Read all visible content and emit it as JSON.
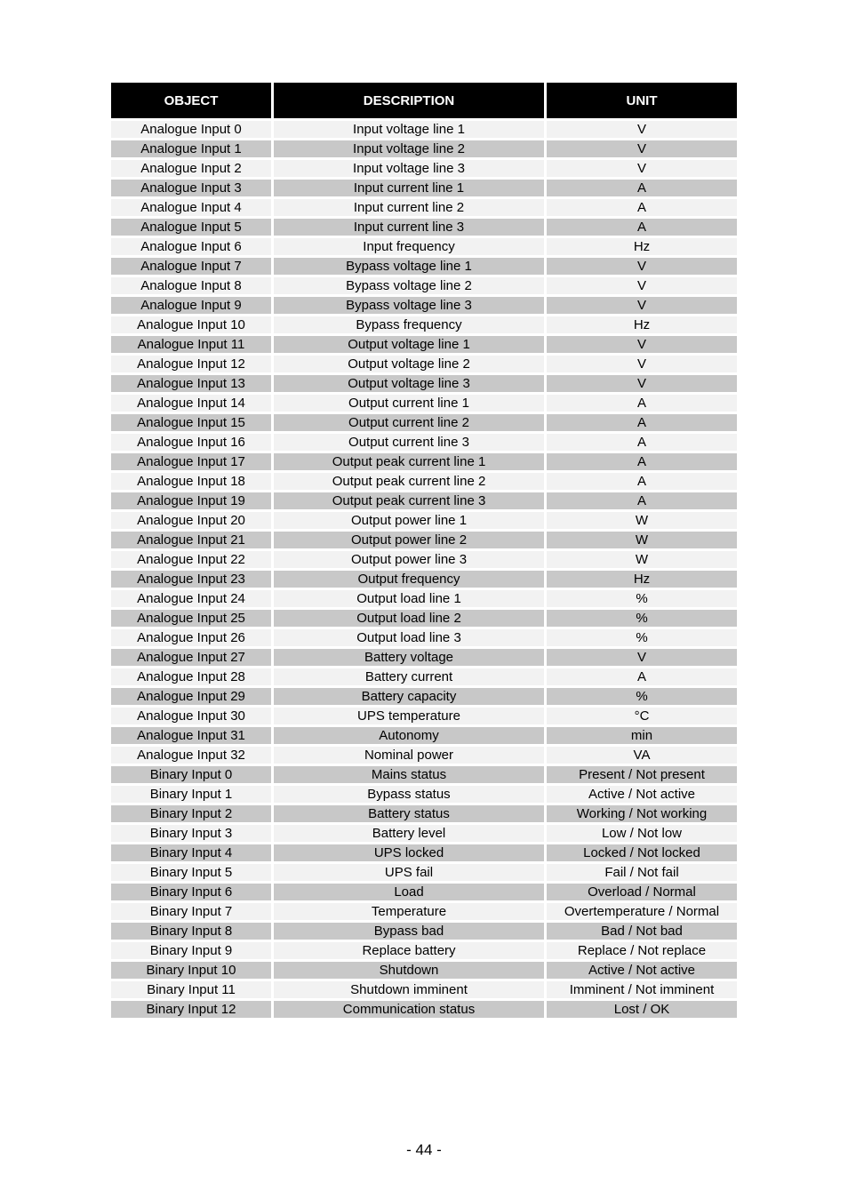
{
  "table": {
    "headers": {
      "object": "OBJECT",
      "description": "DESCRIPTION",
      "unit": "UNIT"
    },
    "colors": {
      "header_bg": "#000000",
      "row_light": "#f2f2f2",
      "row_dark": "#c8c8c8"
    },
    "rows": [
      {
        "object": "Analogue Input 0",
        "description": "Input voltage line 1",
        "unit": "V"
      },
      {
        "object": "Analogue Input 1",
        "description": "Input voltage line 2",
        "unit": "V"
      },
      {
        "object": "Analogue Input 2",
        "description": "Input voltage line 3",
        "unit": "V"
      },
      {
        "object": "Analogue Input 3",
        "description": "Input current line 1",
        "unit": "A"
      },
      {
        "object": "Analogue Input 4",
        "description": "Input current line 2",
        "unit": "A"
      },
      {
        "object": "Analogue Input 5",
        "description": "Input current line 3",
        "unit": "A"
      },
      {
        "object": "Analogue Input 6",
        "description": "Input frequency",
        "unit": "Hz"
      },
      {
        "object": "Analogue Input 7",
        "description": "Bypass voltage line 1",
        "unit": "V"
      },
      {
        "object": "Analogue Input 8",
        "description": "Bypass voltage line 2",
        "unit": "V"
      },
      {
        "object": "Analogue Input 9",
        "description": "Bypass voltage line 3",
        "unit": "V"
      },
      {
        "object": "Analogue Input 10",
        "description": "Bypass frequency",
        "unit": "Hz"
      },
      {
        "object": "Analogue Input 11",
        "description": "Output voltage line 1",
        "unit": "V"
      },
      {
        "object": "Analogue Input 12",
        "description": "Output voltage line 2",
        "unit": "V"
      },
      {
        "object": "Analogue Input 13",
        "description": "Output voltage line 3",
        "unit": "V"
      },
      {
        "object": "Analogue Input 14",
        "description": "Output current line 1",
        "unit": "A"
      },
      {
        "object": "Analogue Input 15",
        "description": "Output current line 2",
        "unit": "A"
      },
      {
        "object": "Analogue Input 16",
        "description": "Output current line 3",
        "unit": "A"
      },
      {
        "object": "Analogue Input 17",
        "description": "Output peak current line 1",
        "unit": "A"
      },
      {
        "object": "Analogue Input 18",
        "description": "Output peak current line 2",
        "unit": "A"
      },
      {
        "object": "Analogue Input 19",
        "description": "Output peak current line 3",
        "unit": "A"
      },
      {
        "object": "Analogue Input 20",
        "description": "Output power line 1",
        "unit": "W"
      },
      {
        "object": "Analogue Input 21",
        "description": "Output power line 2",
        "unit": "W"
      },
      {
        "object": "Analogue Input 22",
        "description": "Output power line 3",
        "unit": "W"
      },
      {
        "object": "Analogue Input 23",
        "description": "Output frequency",
        "unit": "Hz"
      },
      {
        "object": "Analogue Input 24",
        "description": "Output load line 1",
        "unit": "%"
      },
      {
        "object": "Analogue Input 25",
        "description": "Output load line 2",
        "unit": "%"
      },
      {
        "object": "Analogue Input 26",
        "description": "Output load line 3",
        "unit": "%"
      },
      {
        "object": "Analogue Input 27",
        "description": "Battery voltage",
        "unit": "V"
      },
      {
        "object": "Analogue Input 28",
        "description": "Battery current",
        "unit": "A"
      },
      {
        "object": "Analogue Input 29",
        "description": "Battery capacity",
        "unit": "%"
      },
      {
        "object": "Analogue Input 30",
        "description": "UPS temperature",
        "unit": "°C"
      },
      {
        "object": "Analogue Input 31",
        "description": "Autonomy",
        "unit": "min"
      },
      {
        "object": "Analogue Input 32",
        "description": "Nominal power",
        "unit": "VA"
      },
      {
        "object": "Binary Input 0",
        "description": "Mains status",
        "unit": "Present / Not present"
      },
      {
        "object": "Binary Input 1",
        "description": "Bypass status",
        "unit": "Active / Not active"
      },
      {
        "object": "Binary Input 2",
        "description": "Battery status",
        "unit": "Working / Not working"
      },
      {
        "object": "Binary Input 3",
        "description": "Battery level",
        "unit": "Low / Not low"
      },
      {
        "object": "Binary Input 4",
        "description": "UPS locked",
        "unit": "Locked / Not locked"
      },
      {
        "object": "Binary Input 5",
        "description": "UPS fail",
        "unit": "Fail / Not fail"
      },
      {
        "object": "Binary Input 6",
        "description": "Load",
        "unit": "Overload / Normal"
      },
      {
        "object": "Binary Input 7",
        "description": "Temperature",
        "unit": "Overtemperature / Normal"
      },
      {
        "object": "Binary Input 8",
        "description": "Bypass bad",
        "unit": "Bad / Not bad"
      },
      {
        "object": "Binary Input 9",
        "description": "Replace battery",
        "unit": "Replace / Not replace"
      },
      {
        "object": "Binary Input 10",
        "description": "Shutdown",
        "unit": "Active / Not active"
      },
      {
        "object": "Binary Input 11",
        "description": "Shutdown imminent",
        "unit": "Imminent / Not imminent"
      },
      {
        "object": "Binary Input 12",
        "description": "Communication status",
        "unit": "Lost / OK"
      }
    ]
  },
  "footer": {
    "page_number": "- 44 -"
  }
}
